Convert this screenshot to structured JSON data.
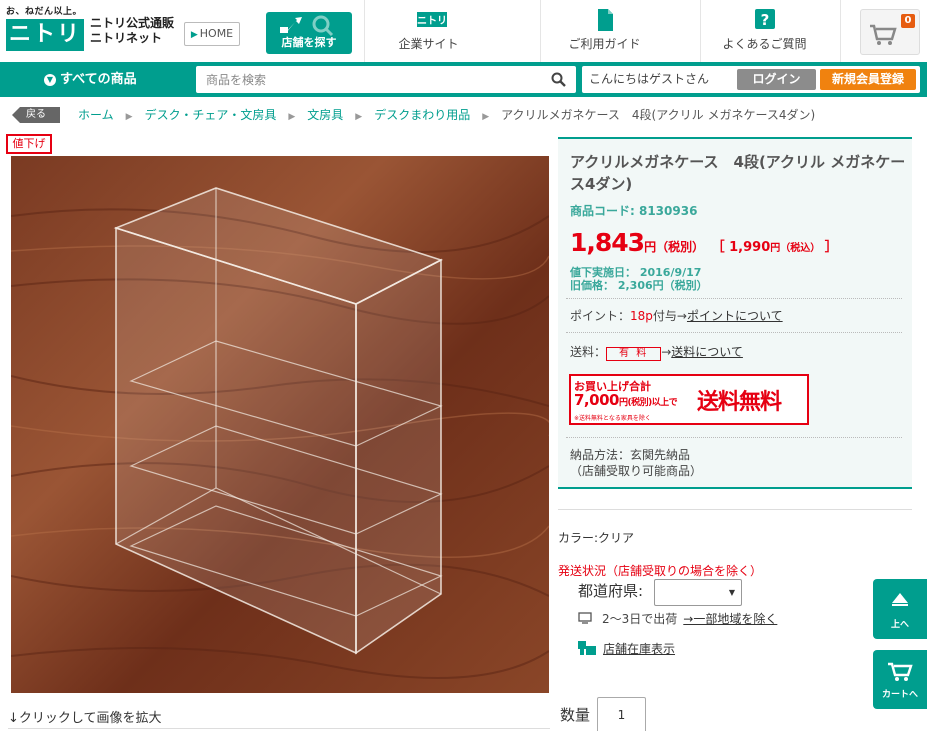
{
  "header": {
    "logo_tagline": "お、ねだん以上。",
    "logo_mark": "ニトリ",
    "logo_text_line1": "ニトリ公式通販",
    "logo_text_line2": "ニトリネット",
    "home_label": "HOME",
    "store_search_label": "店舗を探す",
    "nav": [
      {
        "label": "企業サイト",
        "icon": "nitori-logo-icon"
      },
      {
        "label": "ご利用ガイド",
        "icon": "document-icon"
      },
      {
        "label": "よくあるご質問",
        "icon": "question-icon"
      }
    ],
    "cart_count": "0"
  },
  "greenbar": {
    "all_products": "すべての商品",
    "search_placeholder": "商品を検索",
    "greeting": "こんにちはゲストさん",
    "login": "ログイン",
    "signup": "新規会員登録"
  },
  "breadcrumb": {
    "back": "戻る",
    "items": [
      "ホーム",
      "デスク・チェア・文房具",
      "文房具",
      "デスクまわり用品"
    ],
    "current": "アクリルメガネケース　4段(アクリル メガネケース4ダン)"
  },
  "product": {
    "sale_tag": "値下げ",
    "zoom_hint": "↓クリックして画像を拡大",
    "title": "アクリルメガネケース　4段(アクリル メガネケース4ダン)",
    "code": "商品コード: 8130936",
    "price": "1,843",
    "price_unit": "円（税別）",
    "price_taxin_open": "［ 1,990",
    "price_taxin_unit": "円（税込）",
    "price_taxin_close": " ］",
    "markdown_date": "値下実施日：  2016/9/17",
    "old_price": "旧価格：  2,306円（税別）",
    "points_label": "ポイント：",
    "points_value": "18p",
    "points_suffix": "付与→",
    "points_link": "ポイントについて",
    "shipping_label": "送料：",
    "shipping_fee": "有 料",
    "shipping_arrow": "→",
    "shipping_link": "送料について",
    "free_ship_line1": "お買い上げ合計",
    "free_ship_amount": "7,000",
    "free_ship_unit": "円(税別)以上で",
    "free_ship_note": "※送料無料となる家具を除く",
    "free_ship_big": "送料無料",
    "delivery_line1": "納品方法：玄関先納品",
    "delivery_line2": "（店舗受取り可能商品）",
    "color": "カラー:クリア",
    "ship_status": "発送状況（店舗受取りの場合を除く）",
    "pref_label": "都道府県:",
    "ship_days": "2～3日で出荷",
    "ship_days_link": "→一部地域を除く",
    "store_stock": "店舗在庫表示",
    "qty_label": "数量",
    "qty_value": "1"
  },
  "side": {
    "top": "上へ",
    "cart": "カートへ"
  },
  "colors": {
    "brand": "#009e8e",
    "price_red": "#e60012",
    "signup_orange": "#f0820f"
  }
}
